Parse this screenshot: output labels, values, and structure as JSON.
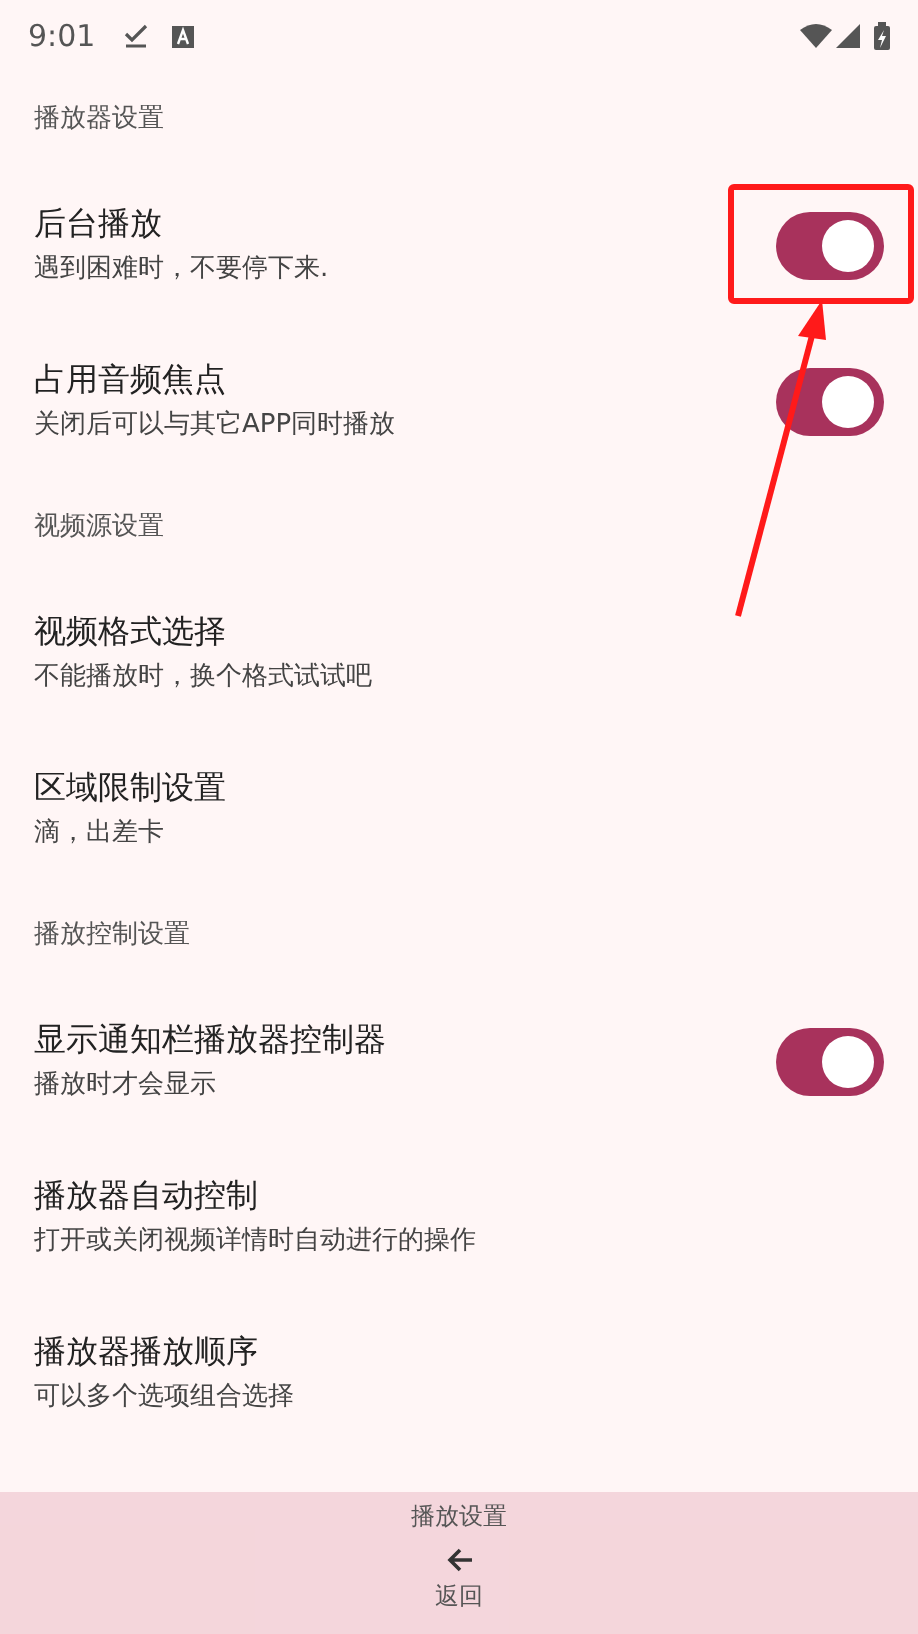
{
  "status_bar": {
    "time": "9:01"
  },
  "sections": [
    {
      "title": "播放器设置",
      "items": [
        {
          "kind": "switch",
          "title": "后台播放",
          "subtitle": "遇到困难时，不要停下来.",
          "on": true,
          "highlighted": true
        },
        {
          "kind": "switch",
          "title": "占用音频焦点",
          "subtitle": "关闭后可以与其它APP同时播放",
          "on": true,
          "highlighted": false
        }
      ]
    },
    {
      "title": "视频源设置",
      "items": [
        {
          "kind": "plain",
          "title": "视频格式选择",
          "subtitle": "不能播放时，换个格式试试吧"
        },
        {
          "kind": "plain",
          "title": "区域限制设置",
          "subtitle": "滴，出差卡"
        }
      ]
    },
    {
      "title": "播放控制设置",
      "items": [
        {
          "kind": "switch",
          "title": "显示通知栏播放器控制器",
          "subtitle": "播放时才会显示",
          "on": true,
          "highlighted": false
        },
        {
          "kind": "plain",
          "title": "播放器自动控制",
          "subtitle": "打开或关闭视频详情时自动进行的操作"
        },
        {
          "kind": "plain",
          "title": "播放器播放顺序",
          "subtitle": "可以多个选项组合选择"
        }
      ]
    }
  ],
  "bottom_bar": {
    "title": "播放设置",
    "back_label": "返回"
  }
}
